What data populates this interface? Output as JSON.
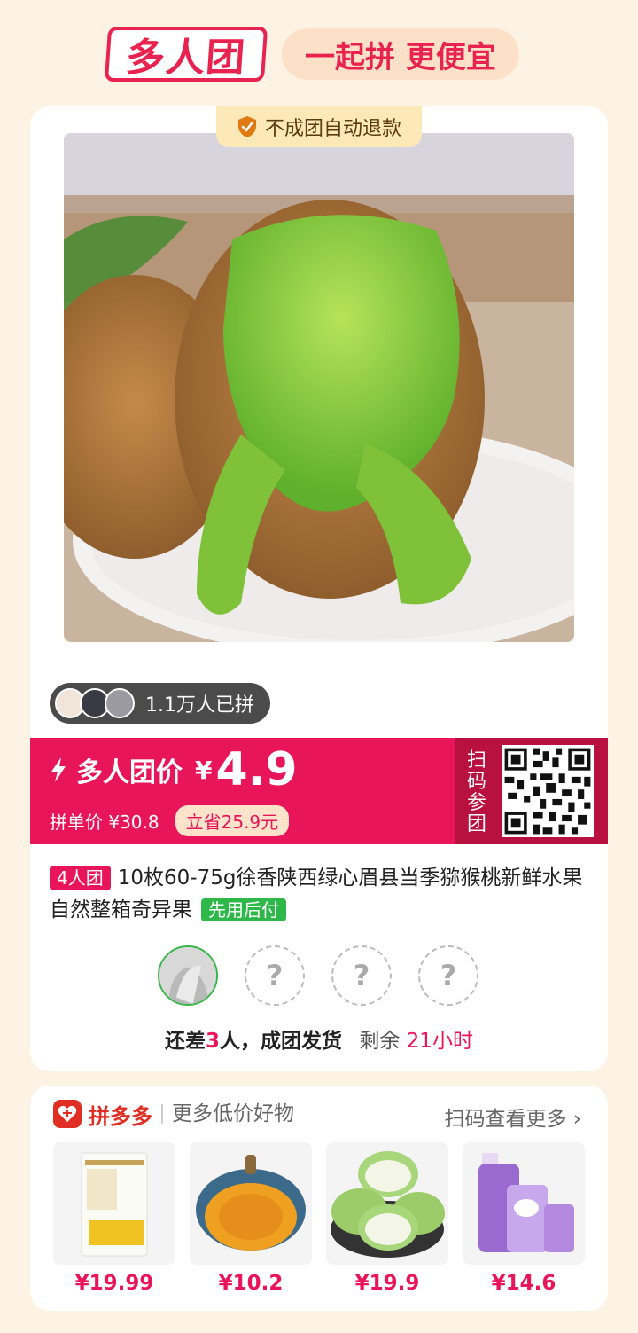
{
  "header": {
    "logo_text": "多人团",
    "slogan": "一起拼 更便宜"
  },
  "card": {
    "refund_tag": "不成团自动退款",
    "joined_count": "1.1万人已拼",
    "price": {
      "label": "多人团价",
      "currency": "¥",
      "value": "4.9",
      "single_label": "拼单价 ¥30.8",
      "save": "立省25.9元"
    },
    "scan_label": "扫码参团",
    "title": {
      "group_tag": "4人团",
      "text": "10枚60-75g徐香陕西绿心眉县当季猕猴桃新鲜水果自然整箱奇异果",
      "pay_tag": "先用后付"
    },
    "slots": {
      "empty_symbol": "?"
    },
    "status": {
      "prefix": "还差",
      "count": "3",
      "middle": "人，成团发货",
      "remain_label": "剩余",
      "remain_time": "21小时"
    }
  },
  "recommend": {
    "brand": "拼多多",
    "subtitle": "更多低价好物",
    "more": "扫码查看更多",
    "products": [
      {
        "name": "flour-bag",
        "price": "¥19.99"
      },
      {
        "name": "pumpkin",
        "price": "¥10.2"
      },
      {
        "name": "guava",
        "price": "¥19.9"
      },
      {
        "name": "fabric-softener",
        "price": "¥14.6"
      }
    ]
  },
  "colors": {
    "accent": "#e9155a",
    "background": "#fdf3e4",
    "green": "#2fb84a"
  }
}
